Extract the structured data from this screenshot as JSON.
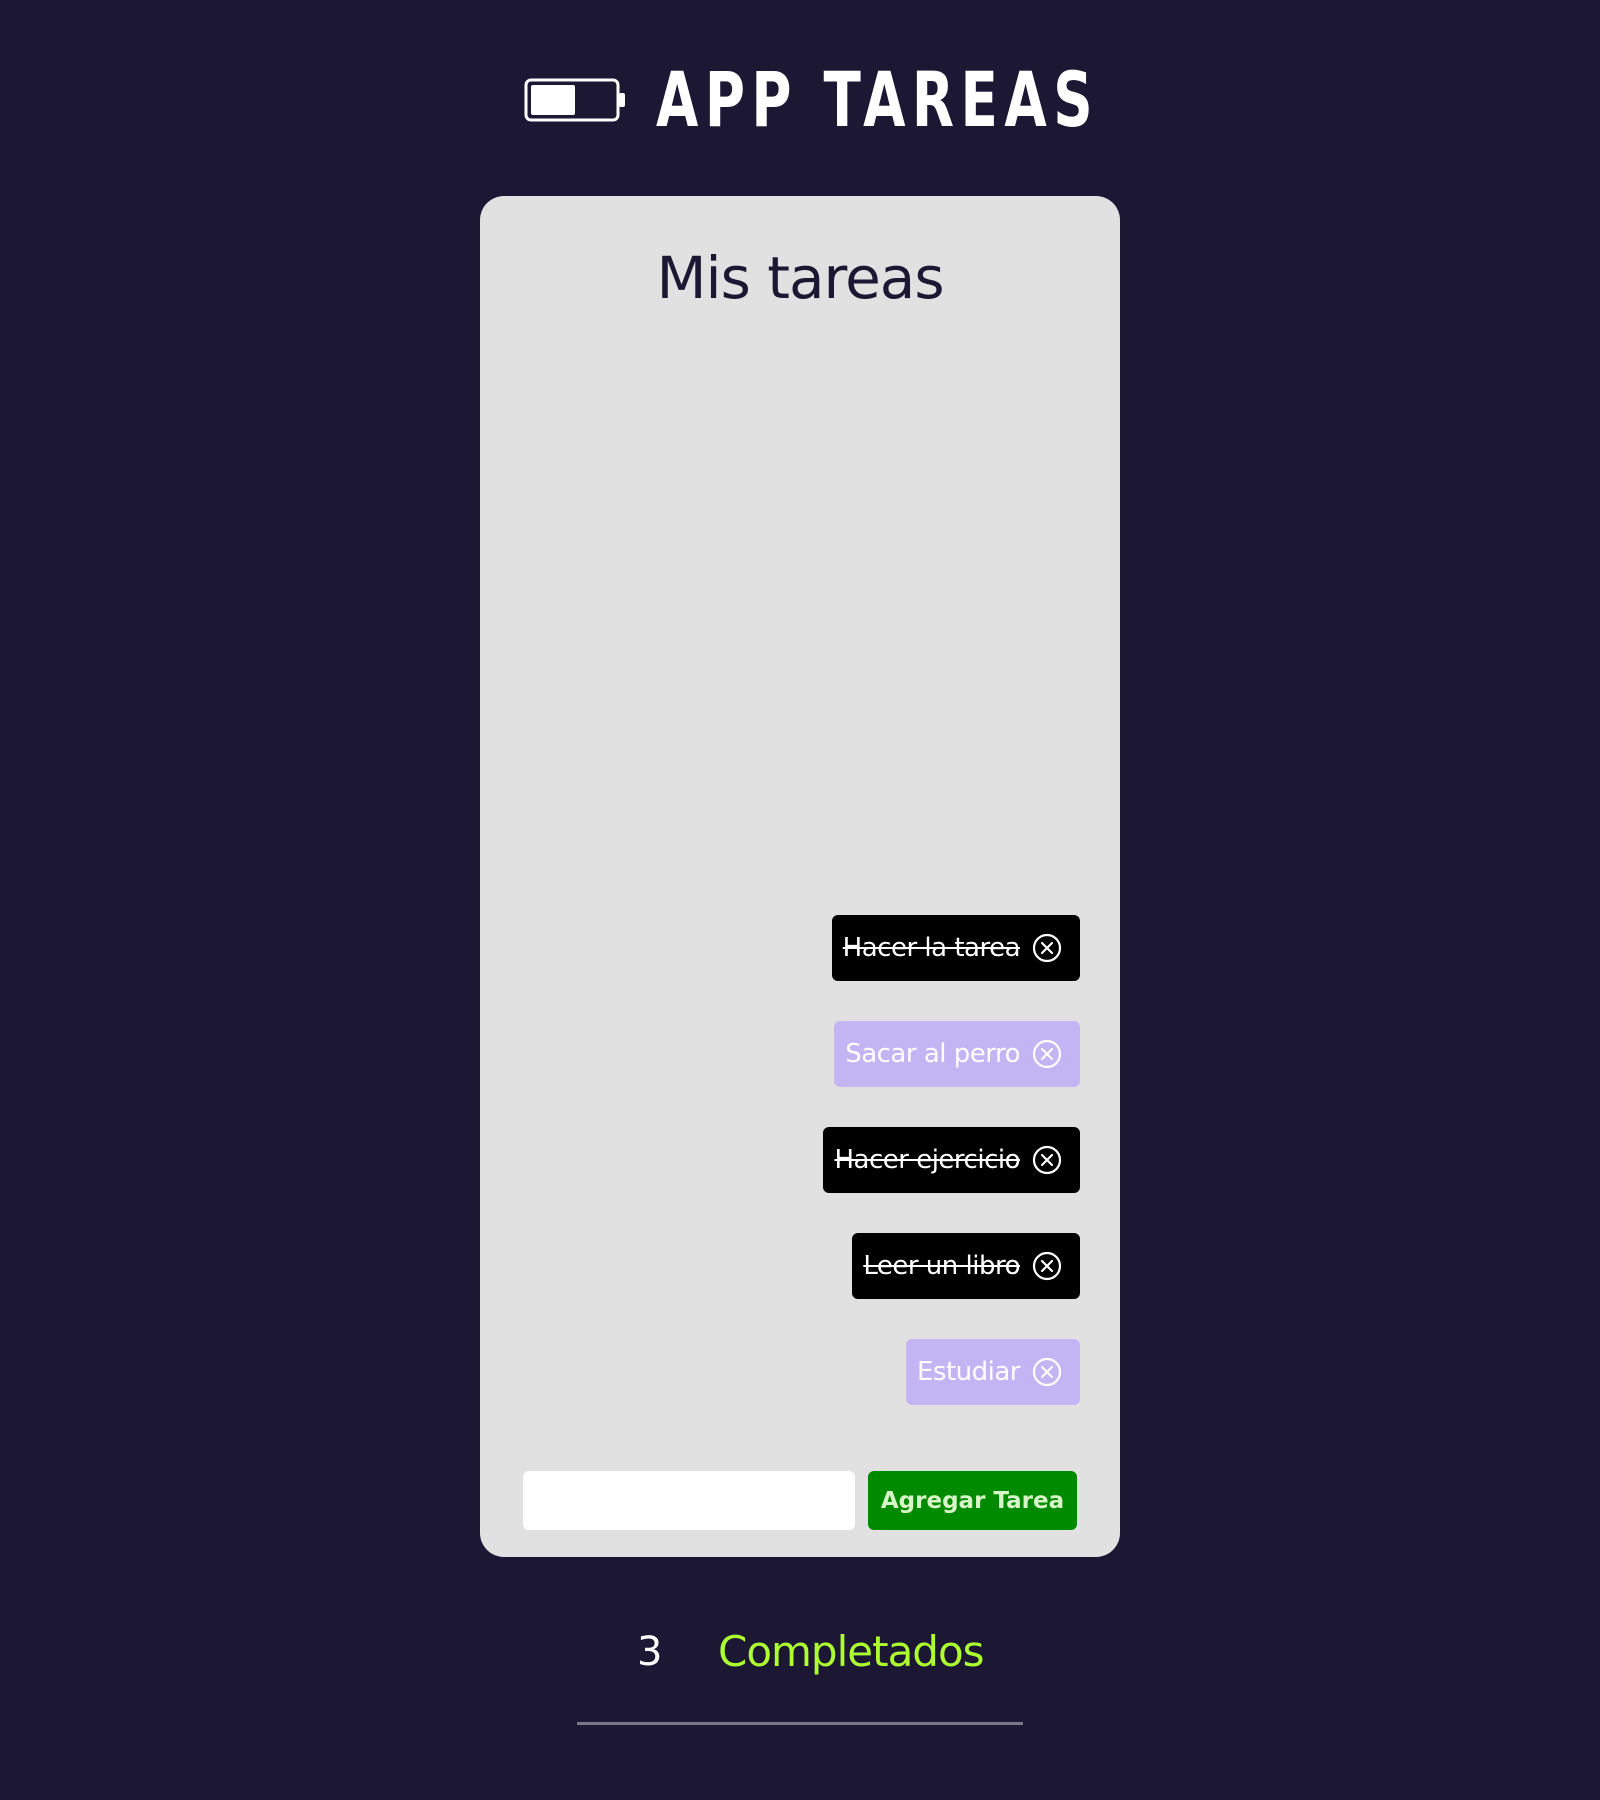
{
  "header": {
    "title": "APP TAREAS",
    "icon": "battery-half-icon"
  },
  "card": {
    "title": "Mis tareas"
  },
  "tasks": [
    {
      "text": "Hacer la tarea",
      "completed": true
    },
    {
      "text": "Sacar al perro",
      "completed": false
    },
    {
      "text": "Hacer ejercicio",
      "completed": true
    },
    {
      "text": "Leer un libro",
      "completed": true
    },
    {
      "text": "Estudiar",
      "completed": false
    }
  ],
  "form": {
    "input_value": "",
    "input_placeholder": "",
    "add_button_label": "Agregar Tarea"
  },
  "counter": {
    "count": "3",
    "label": "Completados"
  },
  "colors": {
    "background": "#1c1733",
    "card": "#e1e1e1",
    "completed_task": "#000000",
    "pending_task": "#c3b4f3",
    "add_button": "#008a00",
    "counter_label": "#adff2f"
  }
}
